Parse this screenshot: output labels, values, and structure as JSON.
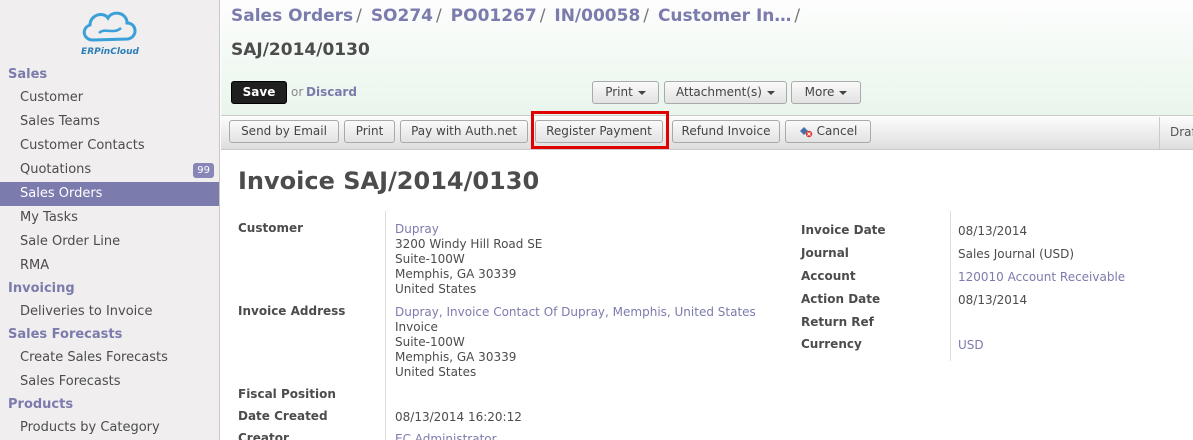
{
  "logo": {
    "text": "ERPinCloud"
  },
  "sidebar": {
    "sections": [
      {
        "title": "Sales",
        "items": [
          {
            "label": "Customer"
          },
          {
            "label": "Sales Teams"
          },
          {
            "label": "Customer Contacts"
          },
          {
            "label": "Quotations",
            "badge": "99"
          },
          {
            "label": "Sales Orders",
            "active": true
          },
          {
            "label": "My Tasks"
          },
          {
            "label": "Sale Order Line"
          },
          {
            "label": "RMA"
          }
        ]
      },
      {
        "title": "Invoicing",
        "items": [
          {
            "label": "Deliveries to Invoice"
          }
        ]
      },
      {
        "title": "Sales Forecasts",
        "items": [
          {
            "label": "Create Sales Forecasts"
          },
          {
            "label": "Sales Forecasts"
          }
        ]
      },
      {
        "title": "Products",
        "items": [
          {
            "label": "Products by Category"
          }
        ]
      }
    ]
  },
  "header": {
    "breadcrumb": [
      "Sales Orders",
      "SO274",
      "PO01267",
      "IN/00058",
      "Customer In…"
    ],
    "separator": "/",
    "record_title": "SAJ/2014/0130",
    "save_label": "Save",
    "or_label": "or",
    "discard_label": "Discard",
    "print_label": "Print",
    "attachments_label": "Attachment(s)",
    "more_label": "More"
  },
  "actionbar": {
    "send_email": "Send by Email",
    "print": "Print",
    "pay_auth": "Pay with Auth.net",
    "register_payment": "Register Payment",
    "refund_invoice": "Refund Invoice",
    "cancel": "Cancel",
    "status": "Draft",
    "highlight_color": "#e00000"
  },
  "invoice": {
    "title": "Invoice SAJ/2014/0130",
    "left": {
      "customer_label": "Customer",
      "customer_name": "Dupray",
      "customer_addr": [
        "3200 Windy Hill Road SE",
        "Suite-100W",
        "Memphis, GA 30339",
        "United States"
      ],
      "invoice_address_label": "Invoice Address",
      "invoice_address_link": "Dupray, Invoice Contact Of Dupray, Memphis, United States",
      "invoice_addr": [
        "Invoice",
        "Suite-100W",
        "Memphis, GA 30339",
        "United States"
      ],
      "fiscal_position_label": "Fiscal Position",
      "date_created_label": "Date Created",
      "date_created": "08/13/2014 16:20:12",
      "creator_label": "Creator",
      "creator": "EC Administrator"
    },
    "right": {
      "invoice_date_label": "Invoice Date",
      "invoice_date": "08/13/2014",
      "journal_label": "Journal",
      "journal": "Sales Journal (USD)",
      "account_label": "Account",
      "account": "120010 Account Receivable",
      "action_date_label": "Action Date",
      "action_date": "08/13/2014",
      "return_ref_label": "Return Ref",
      "currency_label": "Currency",
      "currency": "USD"
    }
  },
  "colors": {
    "accent": "#7c7bad",
    "active_bg": "#7c7bad",
    "header_tint": "#e9f6ec"
  }
}
